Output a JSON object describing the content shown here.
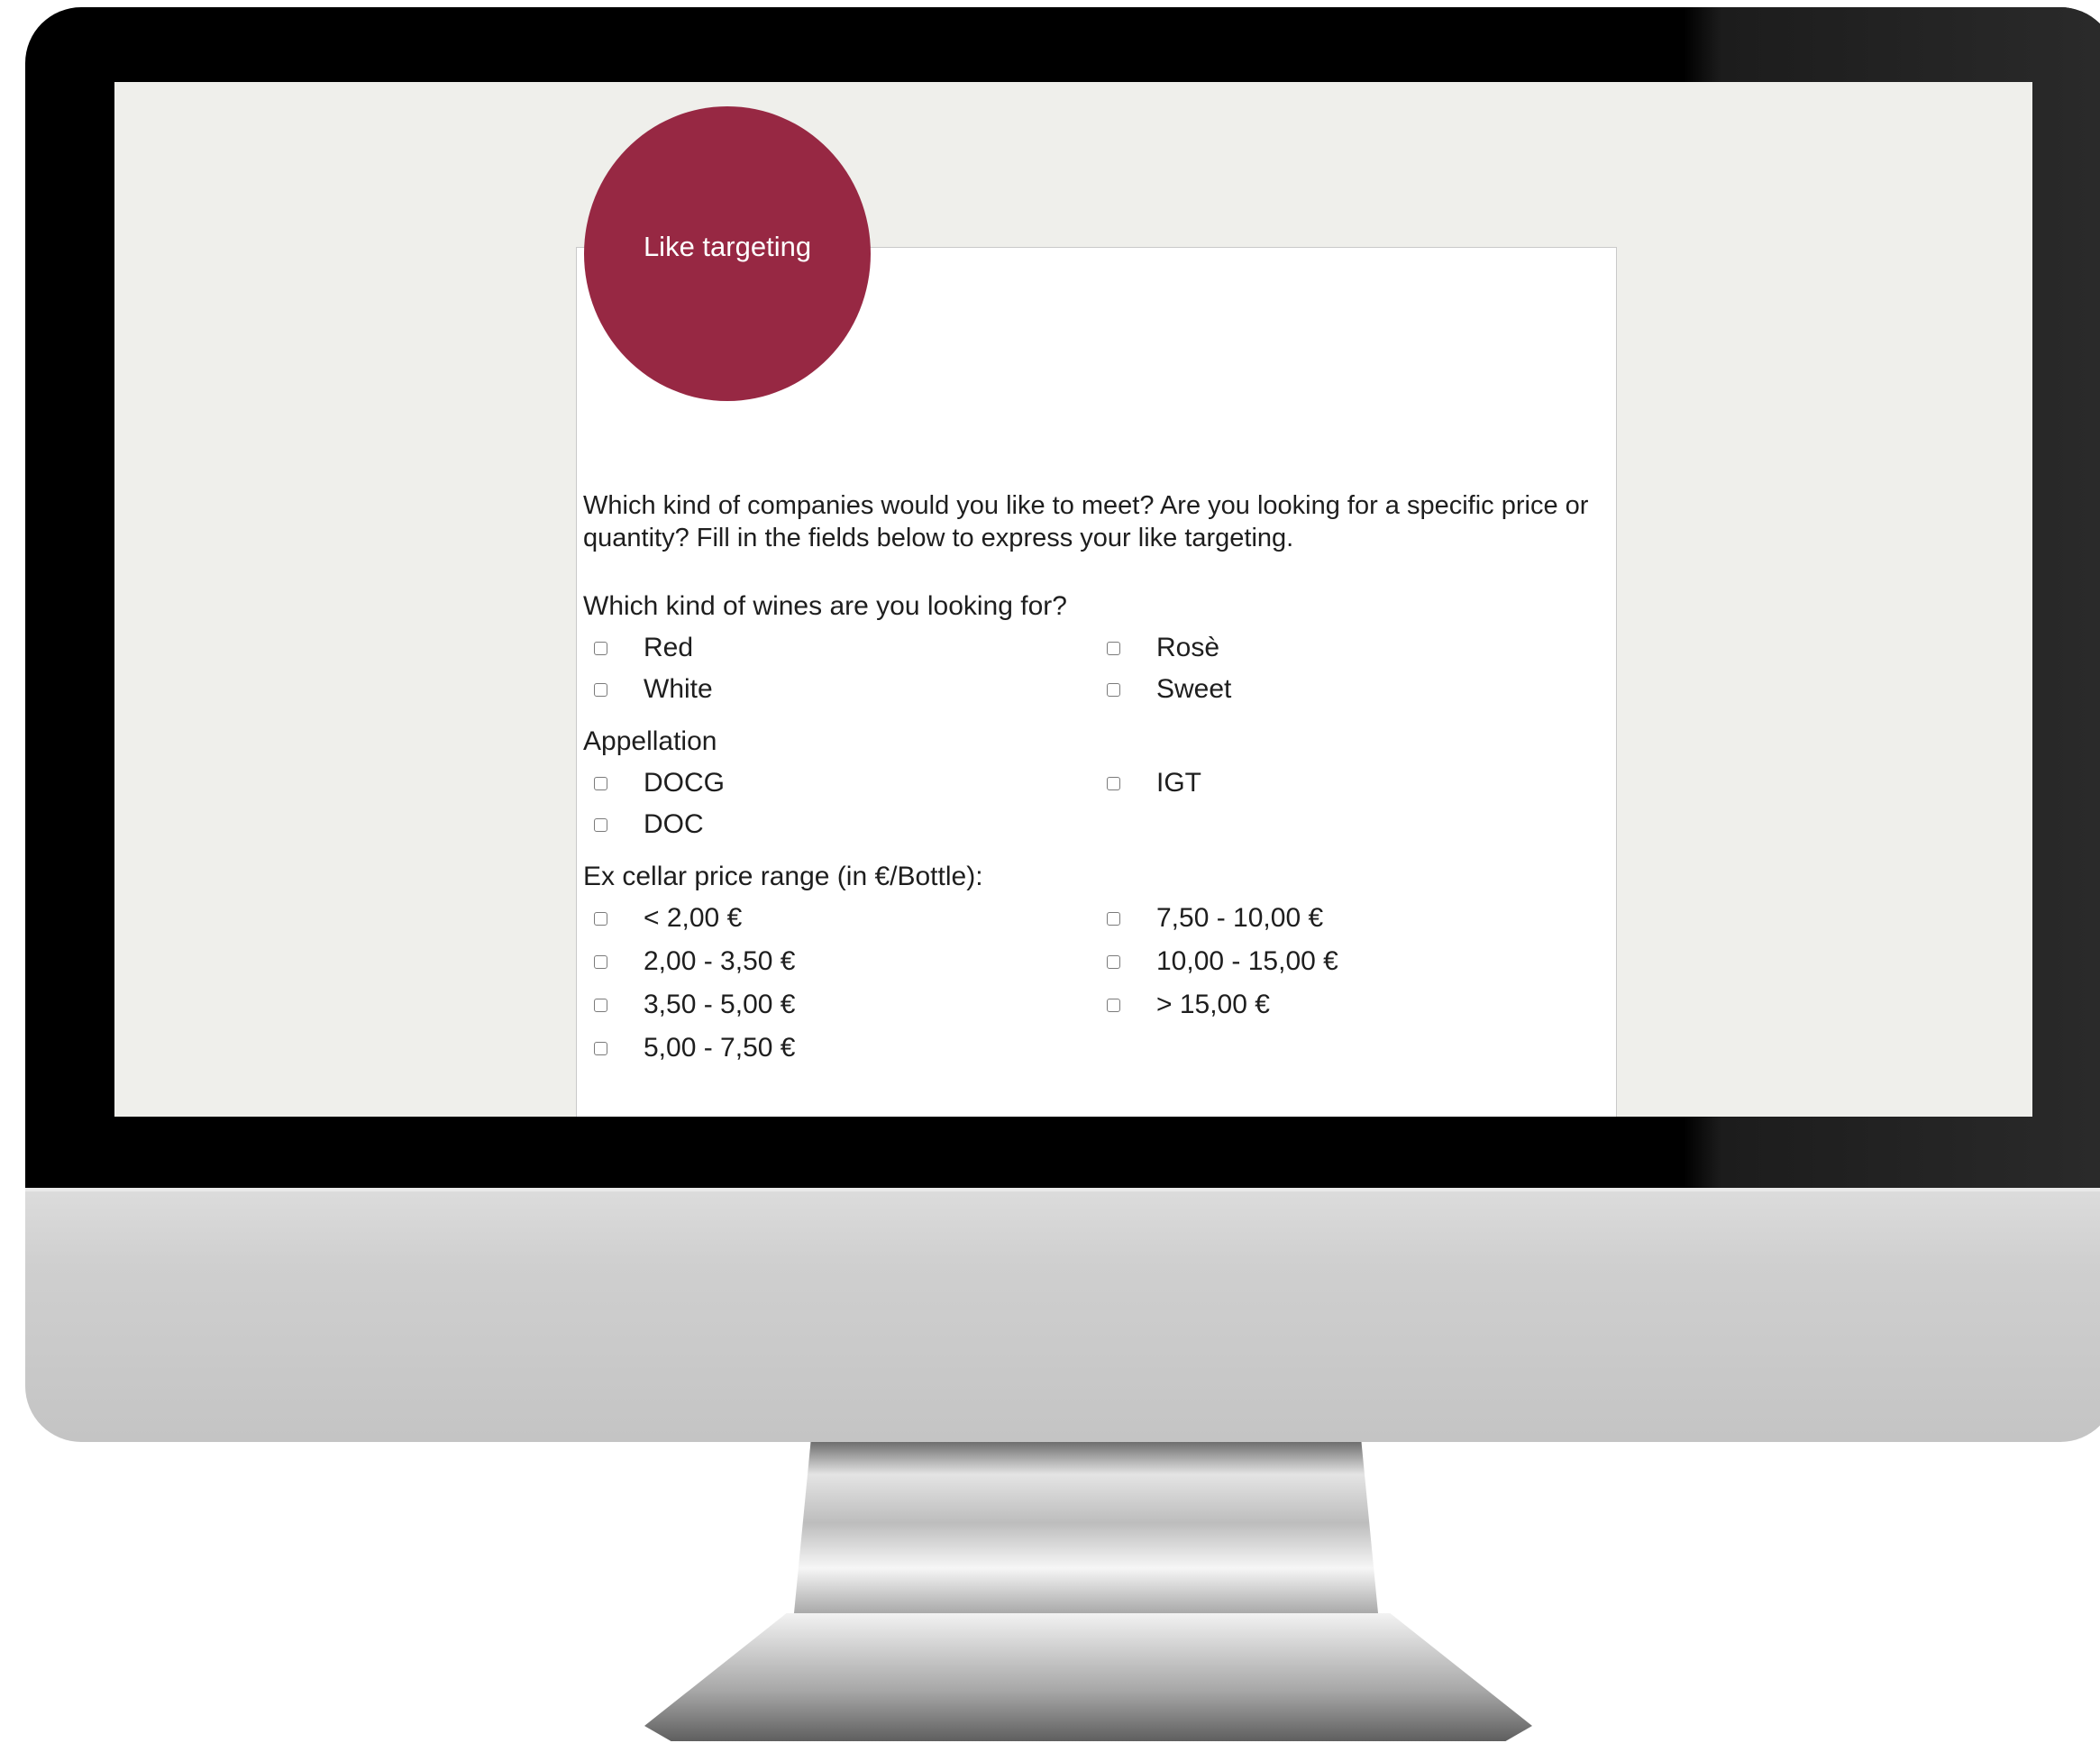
{
  "badge": {
    "label": "Like targeting",
    "color": "#972843"
  },
  "intro": "Which kind of companies would you like to meet? Are you looking for a specific price or quantity? Fill in the fields below to express your like targeting.",
  "wines": {
    "title": "Which kind of wines are you looking for?",
    "options": [
      "Red",
      "Rosè",
      "White",
      "Sweet"
    ]
  },
  "appellation": {
    "title": "Appellation",
    "options": [
      "DOCG",
      "IGT",
      "DOC"
    ]
  },
  "price": {
    "title": "Ex cellar price range (in €/Bottle):",
    "options": [
      "< 2,00 €",
      "7,50 - 10,00 €",
      "2,00 - 3,50 €",
      "10,00 - 15,00 €",
      "3,50 - 5,00 €",
      "> 15,00 €",
      "5,00 - 7,50 €"
    ]
  }
}
